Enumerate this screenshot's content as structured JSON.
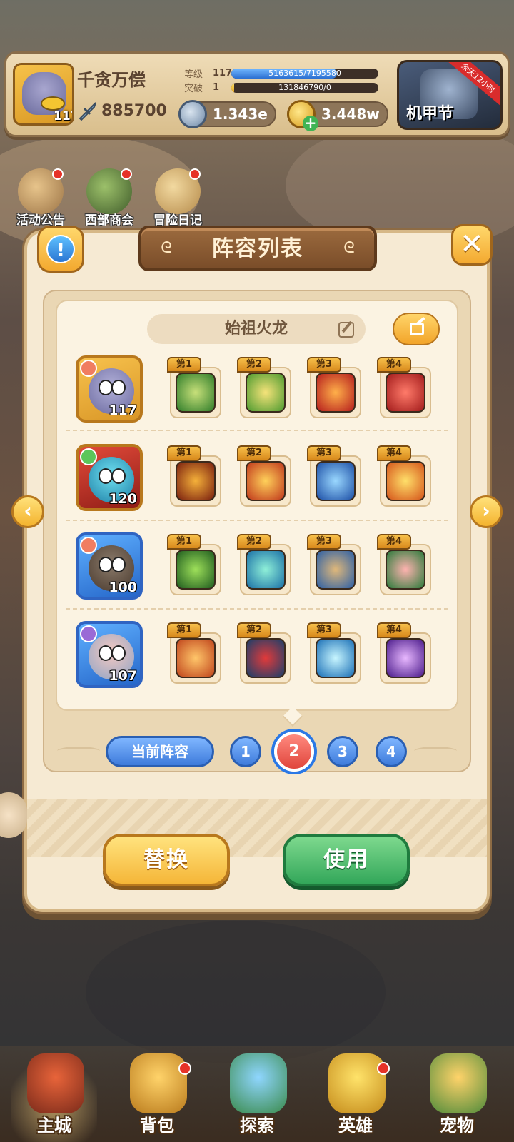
{
  "player": {
    "name": "千贪万偿",
    "level": "117",
    "power": "885700",
    "level_label": "等级",
    "level_value": "117",
    "exp_text": "5163615/7195580",
    "exp_progress": 0.72,
    "break_label": "突破",
    "break_value": "1",
    "break_text": "131846790/0",
    "break_progress": 0.02
  },
  "currencies": [
    {
      "name": "silver-coin",
      "value": "1.343e"
    },
    {
      "name": "gold-coin",
      "value": "3.448w"
    }
  ],
  "event": {
    "label": "机甲节",
    "ribbon": "余天12小时"
  },
  "side_icons": [
    {
      "label": "活动公告"
    },
    {
      "label": "西部商会"
    },
    {
      "label": "冒险日记"
    }
  ],
  "panel": {
    "title": "阵容列表",
    "team_name": "始祖火龙",
    "info_symbol": "!",
    "close_symbol": "✕"
  },
  "rows": [
    {
      "hero_level": "117",
      "skills": [
        "第1",
        "第2",
        "第3",
        "第4"
      ]
    },
    {
      "hero_level": "120",
      "skills": [
        "第1",
        "第2",
        "第3",
        "第4"
      ]
    },
    {
      "hero_level": "100",
      "skills": [
        "第1",
        "第2",
        "第3",
        "第4"
      ]
    },
    {
      "hero_level": "107",
      "skills": [
        "第1",
        "第2",
        "第3",
        "第4"
      ]
    }
  ],
  "team_selector": {
    "label": "当前阵容",
    "numbers": [
      "1",
      "2",
      "3",
      "4"
    ],
    "active": "2"
  },
  "buttons": {
    "replace": "替换",
    "use": "使用"
  },
  "nav": {
    "left": "‹",
    "right": "›"
  },
  "bottom_tabs": [
    {
      "label": "主城",
      "active": true
    },
    {
      "label": "背包"
    },
    {
      "label": "探索"
    },
    {
      "label": "英雄"
    },
    {
      "label": "宠物"
    }
  ]
}
